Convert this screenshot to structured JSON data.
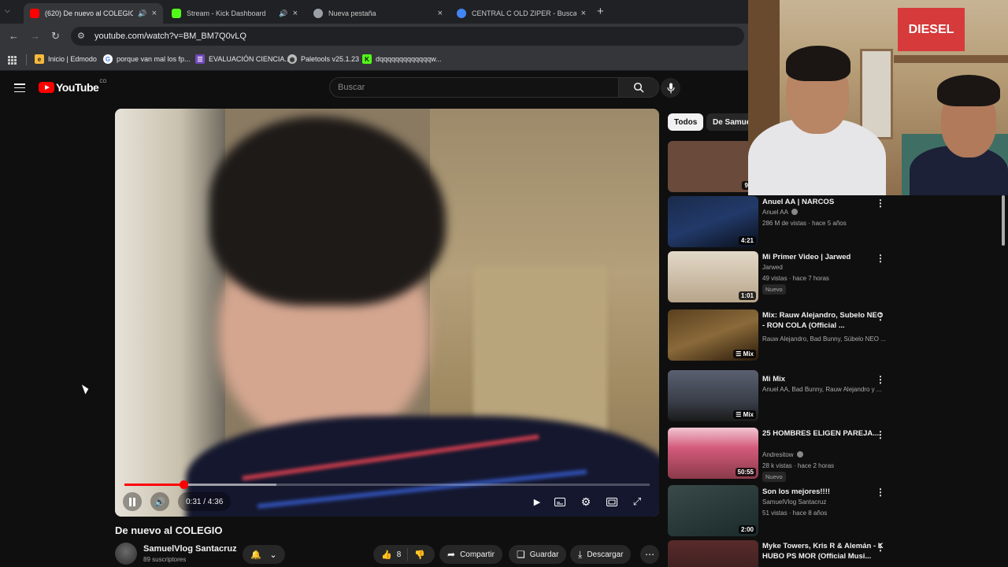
{
  "browser": {
    "tabs": [
      {
        "title": "(620) De nuevo al COLEGIO - ",
        "favicon_color": "#ff0000",
        "active": true,
        "sound": true
      },
      {
        "title": "Stream - Kick Dashboard",
        "favicon_color": "#53fc18",
        "active": false,
        "sound": true
      },
      {
        "title": "Nueva pestaña",
        "favicon_color": "#9aa0a6",
        "active": false,
        "sound": false
      },
      {
        "title": "CENTRAL C OLD ZIPER - Buscar co",
        "favicon_color": "#4285f4",
        "active": false,
        "sound": false
      }
    ],
    "url": "youtube.com/watch?v=BM_BM7Q0vLQ",
    "bookmarks": [
      {
        "label": "Inicio | Edmodo",
        "icon": "edmodo-icon",
        "color": "#f6b93b"
      },
      {
        "label": "porque van mal los fp...",
        "icon": "google-icon",
        "color": "#ffffff"
      },
      {
        "label": "EVALUACIÓN CIENCIA...",
        "icon": "forms-icon",
        "color": "#7248b9"
      },
      {
        "label": "Paletools v25.1.23",
        "icon": "paletools-icon",
        "color": "#bdbdbd"
      },
      {
        "label": "dqqqqqqqqqqqqqw...",
        "icon": "kick-icon",
        "color": "#53fc18"
      }
    ]
  },
  "youtube": {
    "logo_text": "YouTube",
    "country": "CO",
    "search_placeholder": "Buscar",
    "video": {
      "title": "De nuevo al COLEGIO",
      "time": "0:31 / 4:36",
      "progress": 0.112,
      "buffered": 0.29
    },
    "channel": {
      "name": "SamuelVlog Santacruz",
      "subs": "89 suscriptores"
    },
    "actions": {
      "likes": "8",
      "share": "Compartir",
      "save": "Guardar",
      "download": "Descargar"
    },
    "chips": [
      "Todos",
      "De Samuel"
    ],
    "recommendations": [
      {
        "title": "",
        "channel": "",
        "meta": "",
        "duration": "9:5",
        "badge": "",
        "thumb_color": "#6a4a3a"
      },
      {
        "title": "Anuel AA | NARCOS",
        "channel": "Anuel AA",
        "verified": true,
        "meta": "286 M de vistas · hace 5 años",
        "duration": "4:21",
        "badge": "",
        "thumb_color": "#1a2a4a"
      },
      {
        "title": "Mi Primer Video | Jarwed",
        "channel": "Jarwed",
        "verified": false,
        "meta": "49 vistas · hace 7 horas",
        "duration": "1:01",
        "badge": "Nuevo",
        "thumb_color": "#c9b9a4"
      },
      {
        "title": "Mix: Rauw Alejandro, Subelo NEO - RON COLA (Official ...",
        "channel": "Rauw Alejandro, Bad Bunny, Súbelo NEO ...",
        "verified": false,
        "meta": "",
        "duration": "Mix",
        "badge": "",
        "thumb_color": "#5a4020"
      },
      {
        "title": "Mi Mix",
        "channel": "Anuel AA, Bad Bunny, Rauw Alejandro y ...",
        "verified": false,
        "meta": "",
        "duration": "Mix",
        "badge": "",
        "thumb_color": "#3a3f4a"
      },
      {
        "title": "25 HOMBRES ELIGEN PAREJA....",
        "channel": "Andresitow",
        "verified": true,
        "meta": "28 k vistas · hace 2 horas",
        "duration": "50:55",
        "badge": "Nuevo",
        "thumb_color": "#d35a7a"
      },
      {
        "title": "Son los mejores!!!!",
        "channel": "SamuelVlog Santacruz",
        "verified": false,
        "meta": "51 vistas · hace 8 años",
        "duration": "2:00",
        "badge": "",
        "thumb_color": "#2a3a3a"
      },
      {
        "title": "Myke Towers, Kris R & Alemán - K HUBO PS MOR (Official Musi...",
        "channel": "",
        "verified": false,
        "meta": "",
        "duration": "",
        "badge": "",
        "thumb_color": "#3a2a2a"
      }
    ]
  },
  "webcam": {
    "poster_text": "DIESEL"
  }
}
